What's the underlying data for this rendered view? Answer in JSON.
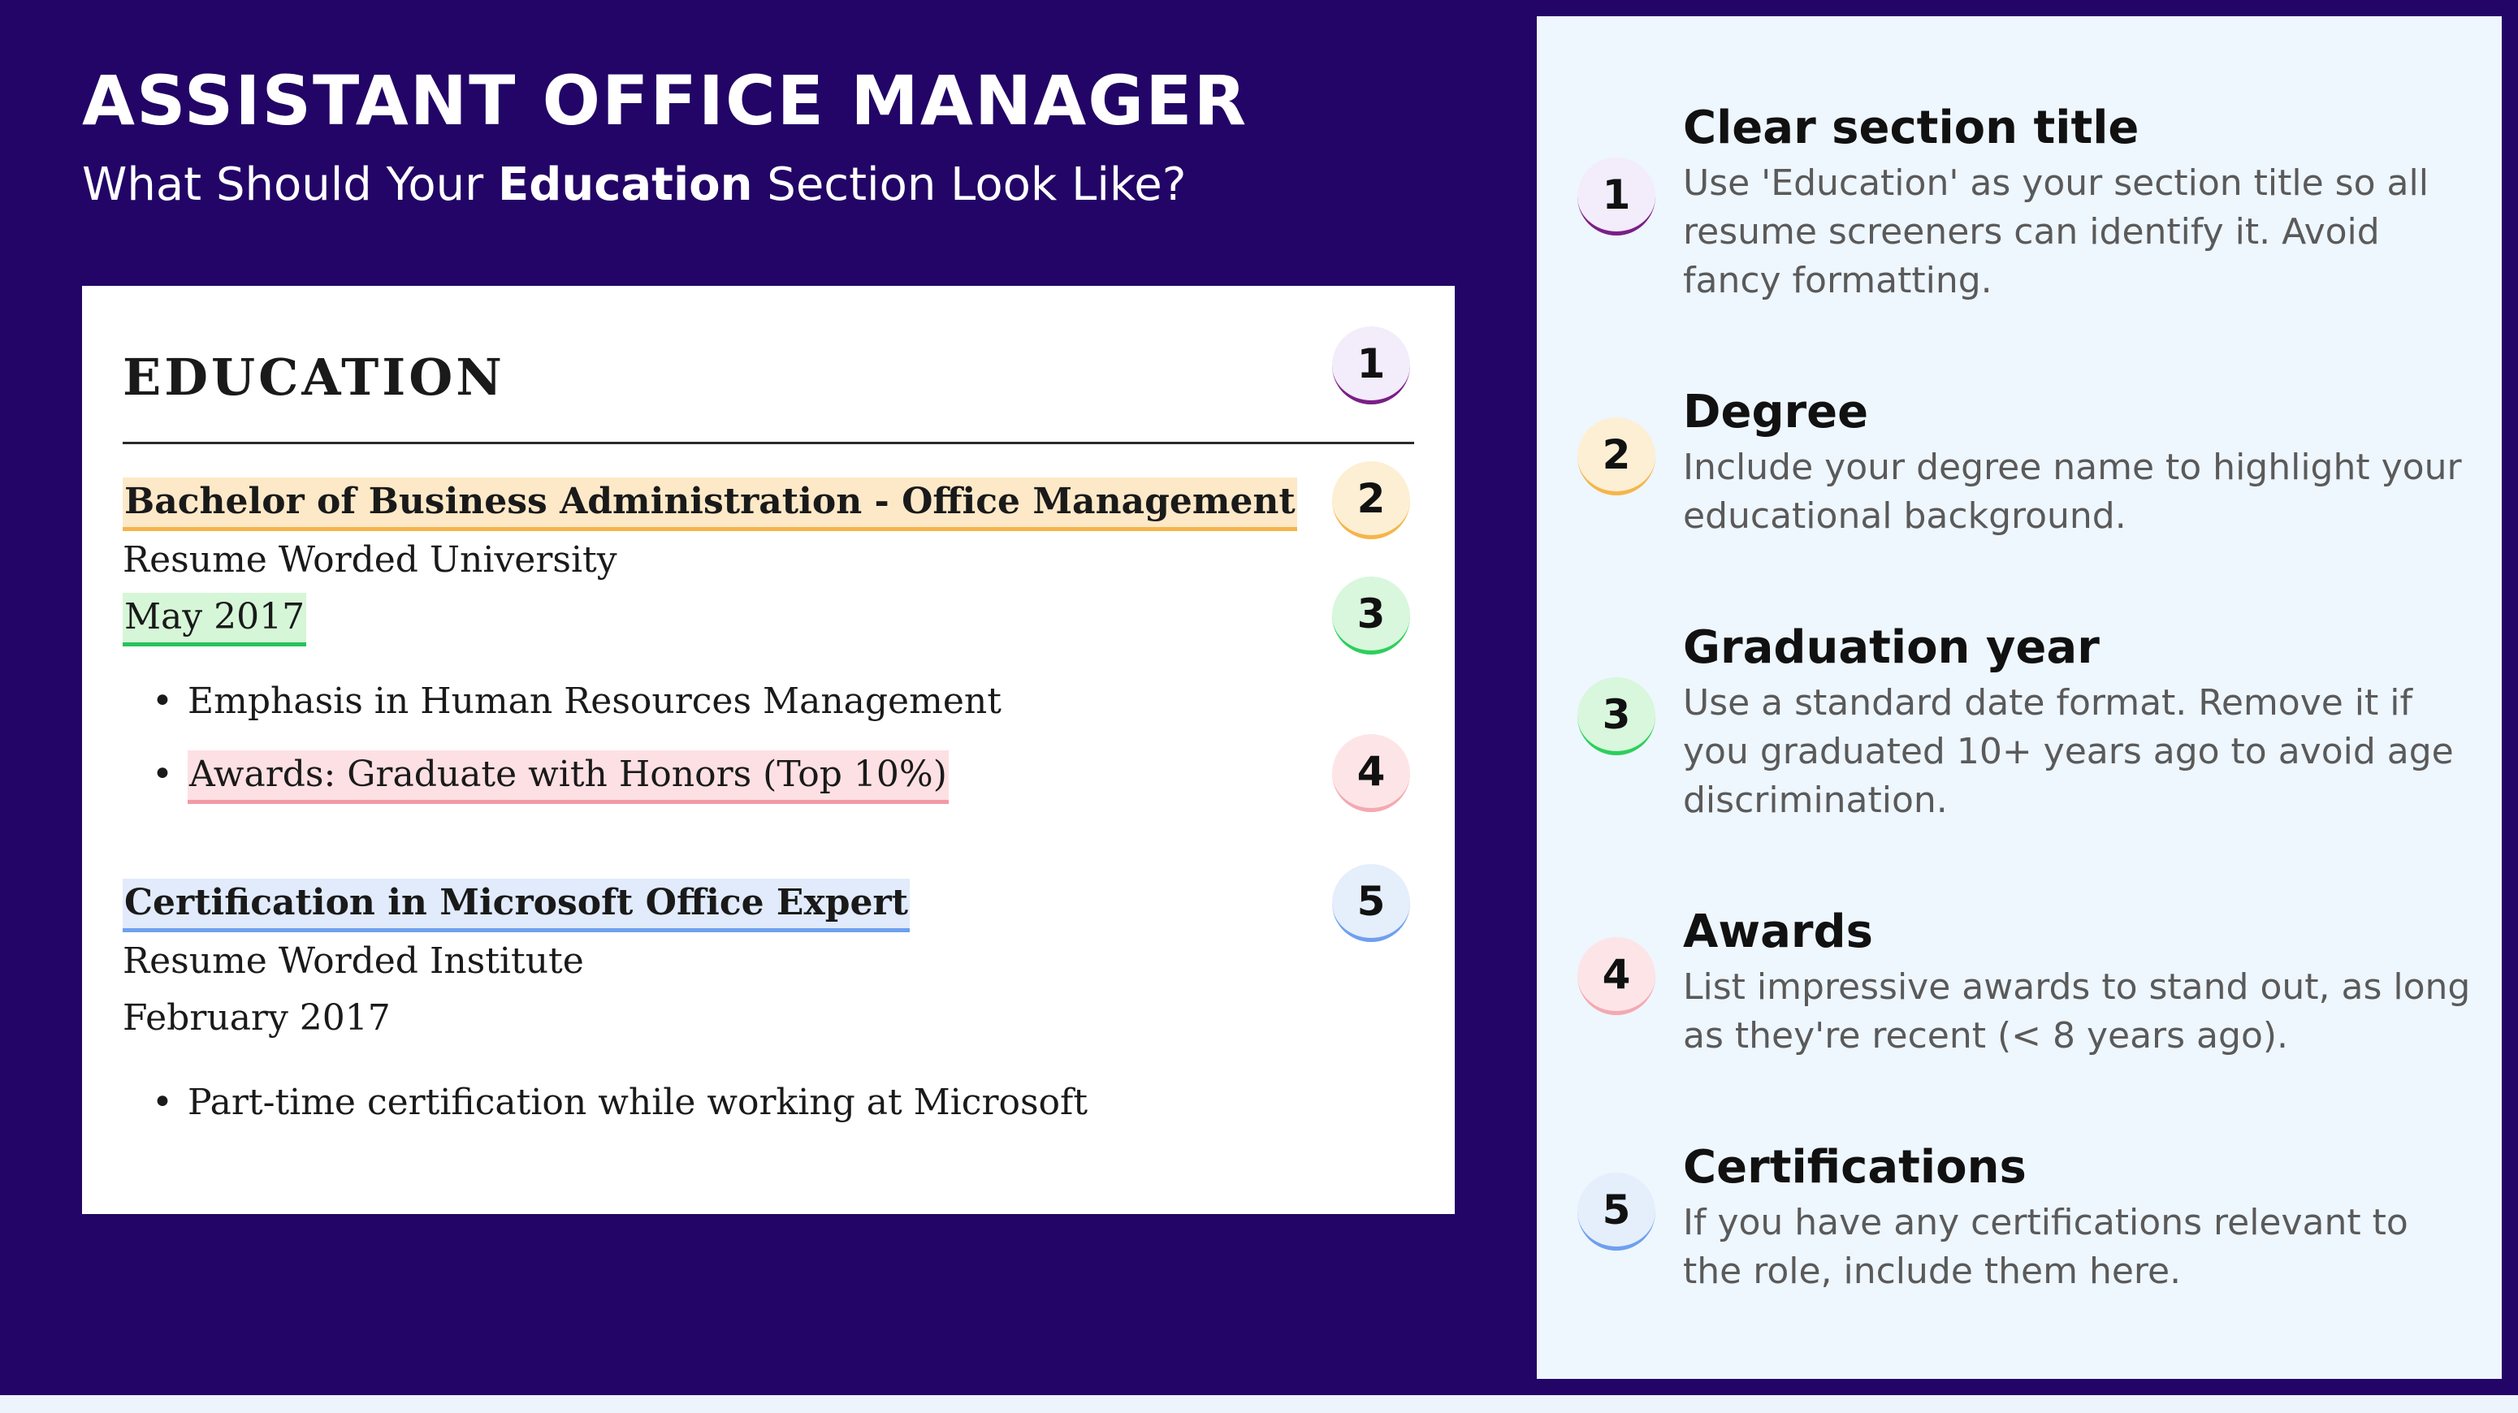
{
  "header": {
    "title": "ASSISTANT OFFICE MANAGER",
    "subtitle_before": "What Should Your ",
    "subtitle_bold": "Education",
    "subtitle_after": " Section Look Like?"
  },
  "resume": {
    "section_heading": "EDUCATION",
    "entries": [
      {
        "degree": "Bachelor of Business Administration - Office Management",
        "institution": "Resume Worded University",
        "date": "May 2017",
        "bullets": [
          "Emphasis in Human Resources Management",
          "Awards: Graduate with Honors (Top 10%)"
        ]
      },
      {
        "degree": "Certification in Microsoft Office Expert",
        "institution": "Resume Worded Institute",
        "date": "February 2017",
        "bullets": [
          "Part-time certification while working at Microsoft"
        ]
      }
    ]
  },
  "badges": [
    "1",
    "2",
    "3",
    "4",
    "5"
  ],
  "tips": [
    {
      "number": "1",
      "title": "Clear section title",
      "body": "Use 'Education' as your section title so all resume screeners can identify it. Avoid fancy formatting."
    },
    {
      "number": "2",
      "title": "Degree",
      "body": "Include your degree name to highlight your educational background."
    },
    {
      "number": "3",
      "title": "Graduation year",
      "body": "Use a standard date format. Remove it if you graduated 10+ years ago to avoid age discrimination."
    },
    {
      "number": "4",
      "title": "Awards",
      "body": "List impressive awards to stand out, as long as they're recent (< 8 years ago)."
    },
    {
      "number": "5",
      "title": "Certifications",
      "body": "If you have any certifications relevant to the role, include them here."
    }
  ],
  "colors": {
    "background": "#220566",
    "panel": "#eef6fe",
    "highlight_degree": "#f5b54a",
    "highlight_date": "#27c35a",
    "highlight_awards": "#f29aa6",
    "highlight_certification": "#6e9ff0",
    "badge_1_accent": "#7a1f86"
  }
}
